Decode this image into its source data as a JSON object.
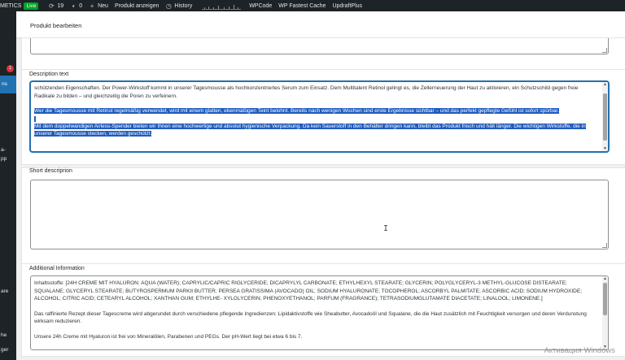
{
  "adminbar": {
    "site": "METICS",
    "live": "Live",
    "updates": "19",
    "comments": "0",
    "new": "Neu",
    "view_product": "Produkt anzeigen",
    "history": "History",
    "wpcode": "WPCode",
    "fastest_cache": "WP Fastest Cache",
    "updraft": "UpdraftPlus"
  },
  "sidebar": {
    "badge": "1",
    "active_fragment": "ns",
    "fragments": [
      "a-",
      "pp",
      "are",
      "he",
      "ger"
    ]
  },
  "header": {
    "title": "Produkt bearbeiten"
  },
  "description": {
    "label": "Description text",
    "para1": "schützenden Eigenschaften. Der Power-Wirkstoff kommt in unserer Tagesmousse als hochkonzentriertes Serum zum Einsatz. Dem Multitalent Retinol gelingt es, die Zellerneuerung der Haut zu aktivieren, ein Schutzschild gegen freie Radikale zu bilden – und gleichzeitig die Poren zu verfeinern.",
    "para2": "Wer die Tagesmousse mit Retinol regelmäßig verwendet, wird mit einem glatten, ebenmäßigen Teint belohnt. Bereits nach wenigen Wochen sind erste Ergebnisse sichtbar – und das perfekt gepflegte Gefühl ist sofort spürbar.",
    "para3": "Mit dem doppelwandigen Airless-Spender bieten wir Ihnen eine hochwertige und absolut hygienische Verpackung. Da kein Sauerstoff in den Behälter dringen kann, bleibt das Produkt frisch und hält länger. Die wichtigen Wirkstoffe, die in unserer Tagesmousse stecken, werden geschützt."
  },
  "short": {
    "label": "Short descriprion",
    "value": ""
  },
  "additional": {
    "label": "Additional Information",
    "para1": "Inhaltsstoffe: [24H CREME MIT HYALURON: AQUA (WATER); CAPRYLIC/CAPRIC RIGLYCERIDE; DICAPRYLYL CARBONATE; ETHYLHEXYL STEARATE; GLYCERIN; POLYGLYCERYL-3 METHYL-GLUCOSE DISTEARATE; SQUALANE; GLYCERYL STEARATE; BUTYROSPERMUM PARKII BUTTER; PERSEA GRATISSIMA (AVOCADO) OIL; SODIUM HYALURONATE; TOCOPHEROL; ASCORBYL PALMITATE; ASCORBIC ACID; SODIUM HYDROXIDE; ALCOHOL; CITRIC ACID; CETEARYL ALCOHOL; XANTHAN GUM; ETHYLHE- XYLGLYCERIN; PHENOXYETHANOL; PARFUM (FRAGRANCE); TETRASODIUMGLUTAMATE DIACETATE; LINALOOL; LIMONENE.]",
    "para2": "Das raffinierte Rezept dieser Tagescreme wird abgerundet durch verschiedene pflegende Ingredienzen: Lipidaktivstoffe wie Sheabutter, Avocadoöl und Squalane, die die Haut zusätzlich mit Feuchtigkeit versorgen und deren Verdunstung wirksam reduzieren.",
    "para3": "Unsere 24h Creme mit Hyaluron ist frei von Mineralölen, Parabenen und PEGs. Der pH-Wert liegt bei etwa 6 bis 7."
  },
  "watermark": "Активация Windows",
  "colors": {
    "accent": "#2271b1",
    "selection": "#1f5bbd",
    "live": "#00a32a",
    "badge": "#d63638"
  }
}
